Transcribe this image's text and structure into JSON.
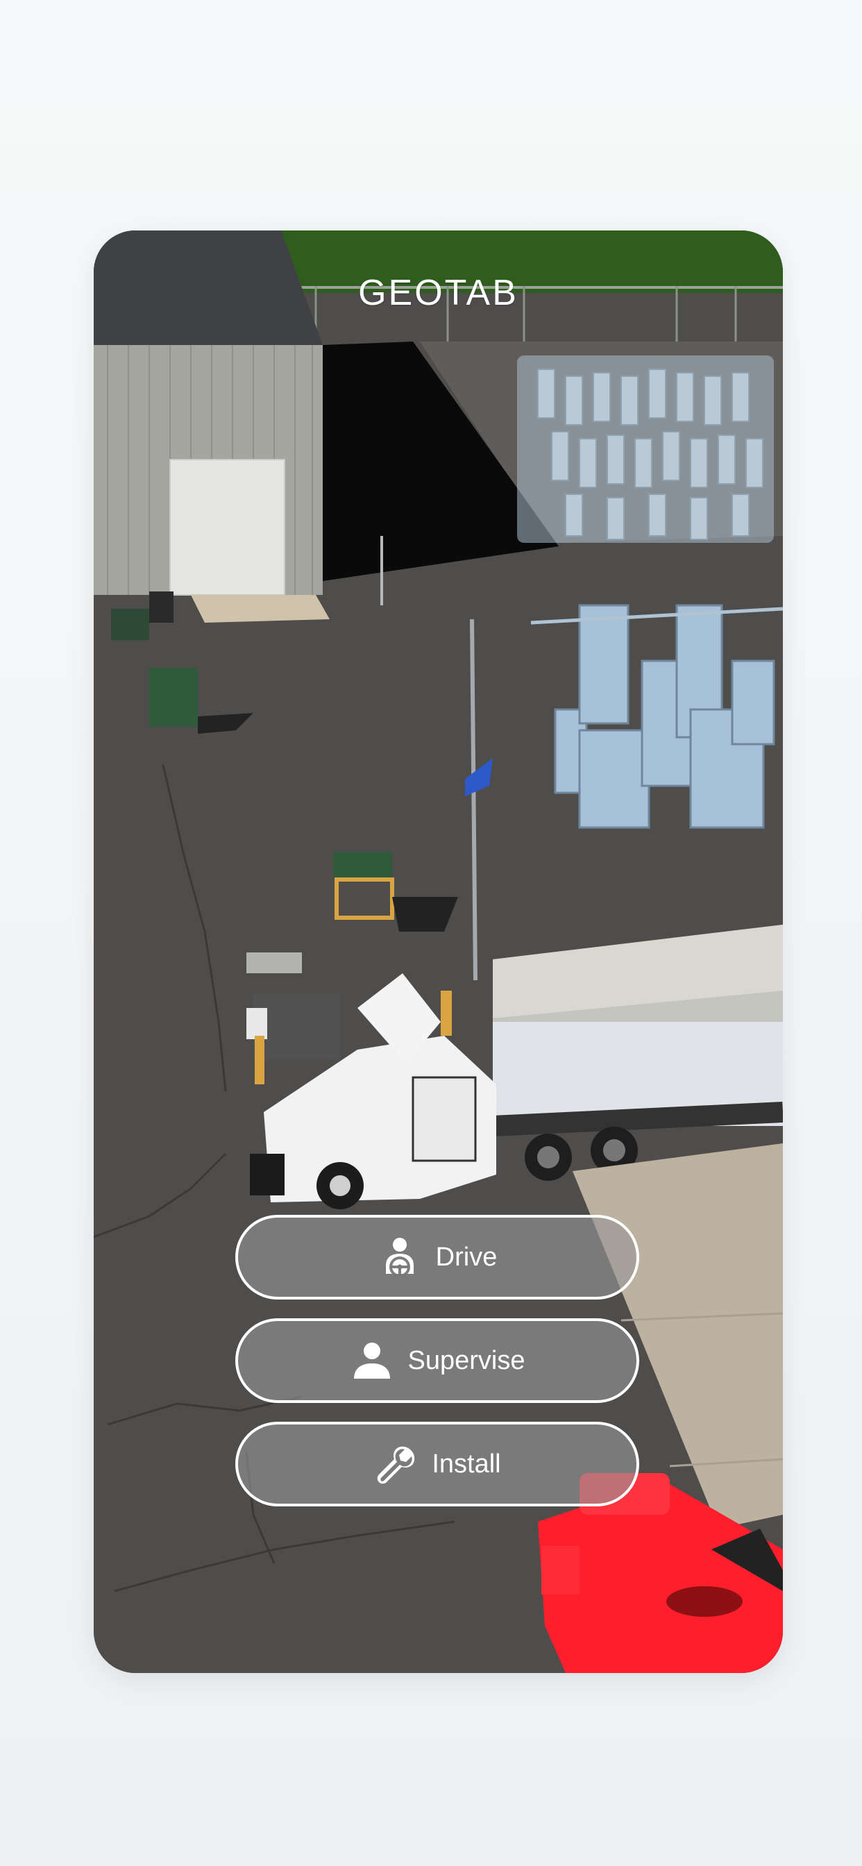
{
  "brand": {
    "logo_text": "GEOTAB"
  },
  "roles": [
    {
      "label": "Drive",
      "icon": "driver-steering-wheel-icon"
    },
    {
      "label": "Supervise",
      "icon": "person-icon"
    },
    {
      "label": "Install",
      "icon": "wrench-icon"
    }
  ],
  "colors": {
    "page_background": "#f3f5f7",
    "button_border": "#ffffff",
    "button_text": "#ffffff",
    "button_fill": "#969696"
  }
}
